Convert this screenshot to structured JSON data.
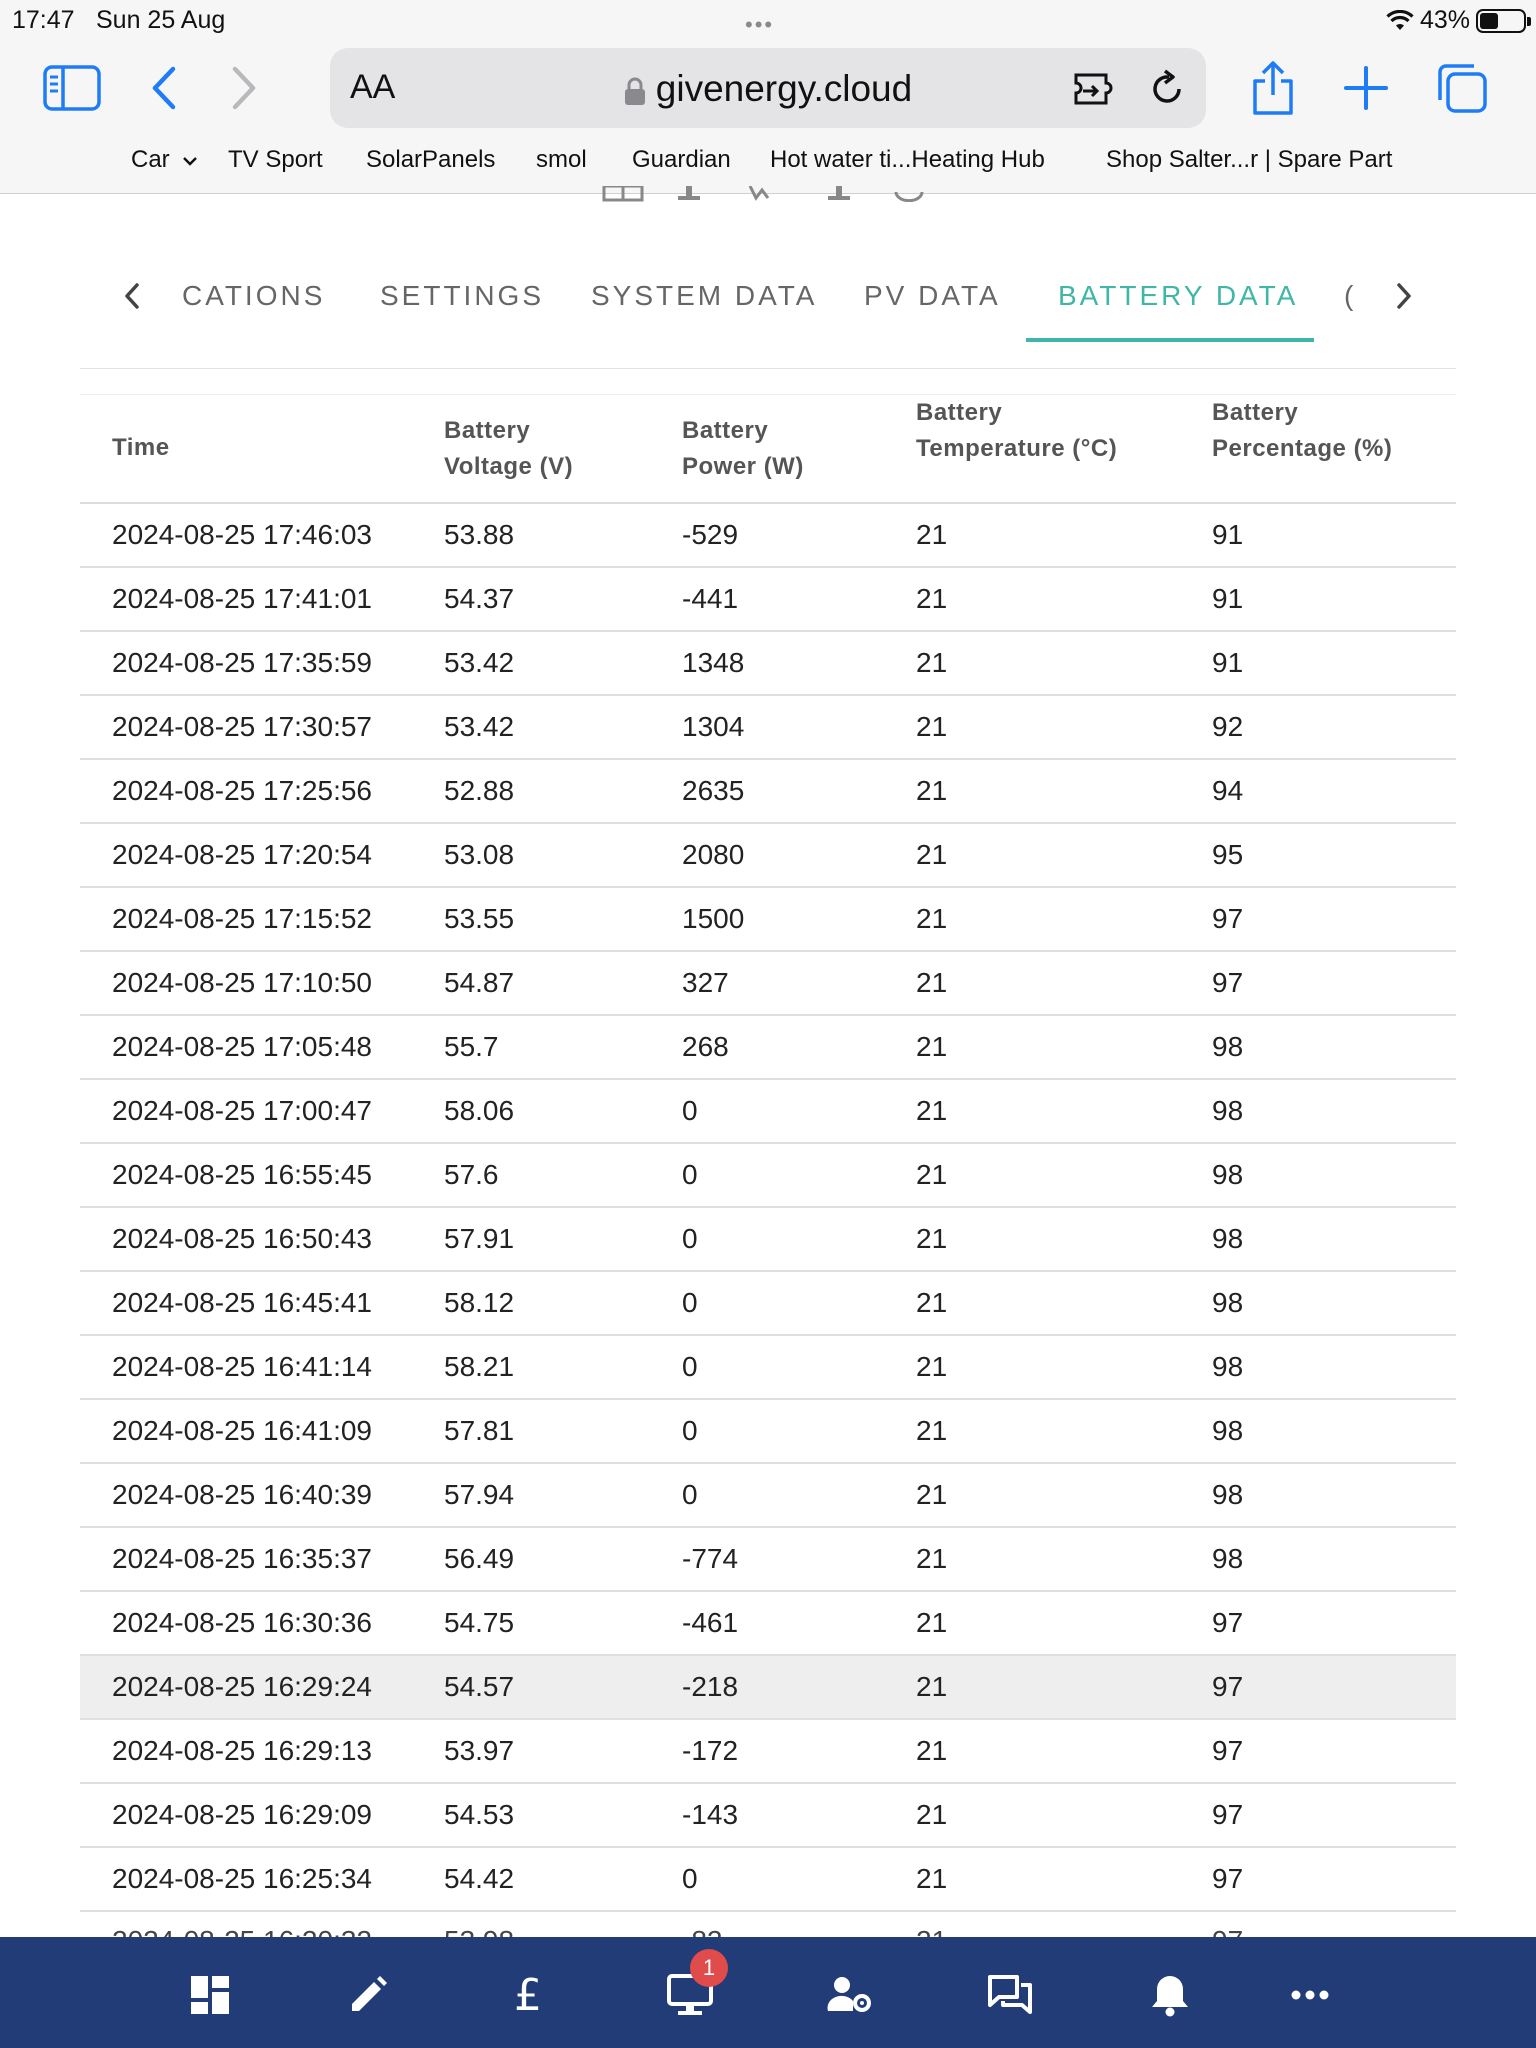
{
  "status": {
    "time": "17:47",
    "date": "Sun 25 Aug",
    "battery": "43%"
  },
  "browser": {
    "aa_label": "AA",
    "url": "givenergy.cloud",
    "bookmarks": [
      "Car",
      "TV Sport",
      "SolarPanels",
      "smol",
      "Guardian",
      "Hot water ti...Heating Hub",
      "Shop Salter...r | Spare Part"
    ]
  },
  "tabs": [
    {
      "label": "CATIONS",
      "active": false
    },
    {
      "label": "SETTINGS",
      "active": false
    },
    {
      "label": "SYSTEM DATA",
      "active": false
    },
    {
      "label": "PV DATA",
      "active": false
    },
    {
      "label": "BATTERY DATA",
      "active": true
    },
    {
      "label": "(",
      "active": false
    }
  ],
  "table": {
    "headers": [
      [
        "Time"
      ],
      [
        "Battery",
        "Voltage (V)"
      ],
      [
        "Battery",
        "Power (W)"
      ],
      [
        "Battery",
        "Temperature (°C)"
      ],
      [
        "Battery",
        "Percentage (%)"
      ]
    ],
    "rows": [
      [
        "2024-08-25 17:46:03",
        "53.88",
        "-529",
        "21",
        "91"
      ],
      [
        "2024-08-25 17:41:01",
        "54.37",
        "-441",
        "21",
        "91"
      ],
      [
        "2024-08-25 17:35:59",
        "53.42",
        "1348",
        "21",
        "91"
      ],
      [
        "2024-08-25 17:30:57",
        "53.42",
        "1304",
        "21",
        "92"
      ],
      [
        "2024-08-25 17:25:56",
        "52.88",
        "2635",
        "21",
        "94"
      ],
      [
        "2024-08-25 17:20:54",
        "53.08",
        "2080",
        "21",
        "95"
      ],
      [
        "2024-08-25 17:15:52",
        "53.55",
        "1500",
        "21",
        "97"
      ],
      [
        "2024-08-25 17:10:50",
        "54.87",
        "327",
        "21",
        "97"
      ],
      [
        "2024-08-25 17:05:48",
        "55.7",
        "268",
        "21",
        "98"
      ],
      [
        "2024-08-25 17:00:47",
        "58.06",
        "0",
        "21",
        "98"
      ],
      [
        "2024-08-25 16:55:45",
        "57.6",
        "0",
        "21",
        "98"
      ],
      [
        "2024-08-25 16:50:43",
        "57.91",
        "0",
        "21",
        "98"
      ],
      [
        "2024-08-25 16:45:41",
        "58.12",
        "0",
        "21",
        "98"
      ],
      [
        "2024-08-25 16:41:14",
        "58.21",
        "0",
        "21",
        "98"
      ],
      [
        "2024-08-25 16:41:09",
        "57.81",
        "0",
        "21",
        "98"
      ],
      [
        "2024-08-25 16:40:39",
        "57.94",
        "0",
        "21",
        "98"
      ],
      [
        "2024-08-25 16:35:37",
        "56.49",
        "-774",
        "21",
        "98"
      ],
      [
        "2024-08-25 16:30:36",
        "54.75",
        "-461",
        "21",
        "97"
      ],
      [
        "2024-08-25 16:29:24",
        "54.57",
        "-218",
        "21",
        "97"
      ],
      [
        "2024-08-25 16:29:13",
        "53.97",
        "-172",
        "21",
        "97"
      ],
      [
        "2024-08-25 16:29:09",
        "54.53",
        "-143",
        "21",
        "97"
      ],
      [
        "2024-08-25 16:25:34",
        "54.42",
        "0",
        "21",
        "97"
      ]
    ],
    "highlighted_row": 18
  },
  "bottom_nav": {
    "items": [
      "dashboard-icon",
      "edit-icon",
      "pound-icon",
      "monitor-icon",
      "account-settings-icon",
      "chat-icon",
      "bell-icon",
      "more-icon"
    ],
    "notification_count": "1"
  },
  "colors": {
    "accent": "#3fb6a6",
    "nav_bg": "#223c78",
    "badge": "#e04b4b",
    "ios_blue": "#1e7cf5"
  }
}
